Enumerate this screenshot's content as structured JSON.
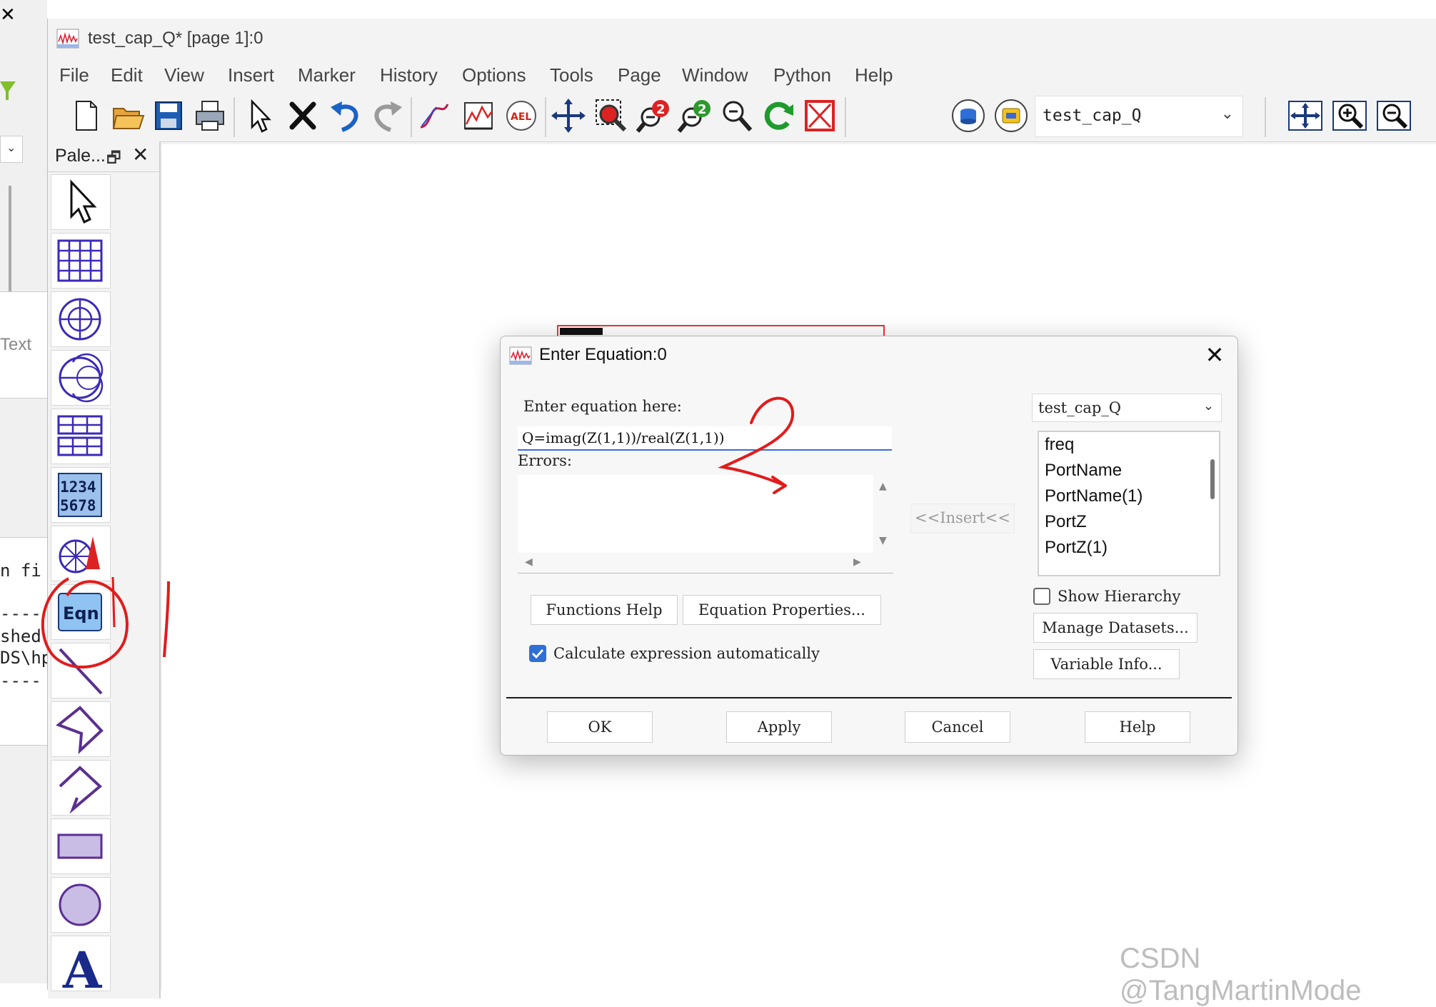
{
  "background_window": {
    "close_glyph": "✕",
    "text_label": "Text",
    "text_fragments": [
      "n fi",
      "----",
      "shed",
      "DS\\hp",
      "----"
    ]
  },
  "window": {
    "title": "test_cap_Q* [page 1]:0",
    "logo_icon": "waveform-logo-icon"
  },
  "menu": [
    "File",
    "Edit",
    "View",
    "Insert",
    "Marker",
    "History",
    "Options",
    "Tools",
    "Page",
    "Window",
    "Python",
    "Help"
  ],
  "toolbar": {
    "dataset_value": "test_cap_Q",
    "icons": [
      "new-file-icon",
      "open-folder-icon",
      "save-icon",
      "print-icon",
      "select-arrow-icon",
      "delete-x-icon",
      "undo-icon",
      "redo-icon",
      "trace-icon",
      "plot-icon",
      "ael-icon",
      "move-icon",
      "zoom-area-icon",
      "zoom-in-2-icon",
      "zoom-out-2-icon",
      "zoom-fit-icon",
      "refresh-icon",
      "stop-icon",
      "database-icon",
      "dataset-icon",
      "pan-icon",
      "zoom-plus-icon",
      "zoom-minus-icon"
    ]
  },
  "palette": {
    "title": "Pale...",
    "restore_glyph": "🗗",
    "close_glyph": "✕",
    "items": [
      {
        "name": "select",
        "label": ""
      },
      {
        "name": "rectangular-plot",
        "label": ""
      },
      {
        "name": "polar-plot",
        "label": ""
      },
      {
        "name": "smith-chart",
        "label": ""
      },
      {
        "name": "list",
        "label": ""
      },
      {
        "name": "stacked-rect-plot",
        "label": "1234\n5678"
      },
      {
        "name": "antenna-plot",
        "label": ""
      },
      {
        "name": "equation",
        "label": "Eqn"
      },
      {
        "name": "line",
        "label": ""
      },
      {
        "name": "polyline",
        "label": ""
      },
      {
        "name": "polygon",
        "label": ""
      },
      {
        "name": "rectangle",
        "label": ""
      },
      {
        "name": "circle",
        "label": ""
      },
      {
        "name": "text",
        "label": "A"
      }
    ]
  },
  "dialog": {
    "title": "Enter Equation:0",
    "close_glyph": "✕",
    "enter_label": "Enter equation here:",
    "equation": "Q=imag(Z(1,1))/real(Z(1,1))",
    "errors_label": "Errors:",
    "insert_label": "<<Insert<<",
    "dataset": "test_cap_Q",
    "variables": [
      "freq",
      "PortName",
      "PortName(1)",
      "PortZ",
      "PortZ(1)"
    ],
    "show_hierarchy_label": "Show Hierarchy",
    "show_hierarchy_checked": false,
    "manage_datasets_label": "Manage Datasets...",
    "variable_info_label": "Variable Info...",
    "functions_help_label": "Functions Help",
    "equation_properties_label": "Equation Properties...",
    "calc_auto_label": "Calculate expression automatically",
    "calc_auto_checked": true,
    "buttons": [
      "OK",
      "Apply",
      "Cancel",
      "Help"
    ]
  },
  "watermark": "CSDN @TangMartinMode",
  "colors": {
    "accent": "#2f6fd6",
    "annotation_red": "#e21b1b",
    "palette_purple": "#5b2f91"
  }
}
